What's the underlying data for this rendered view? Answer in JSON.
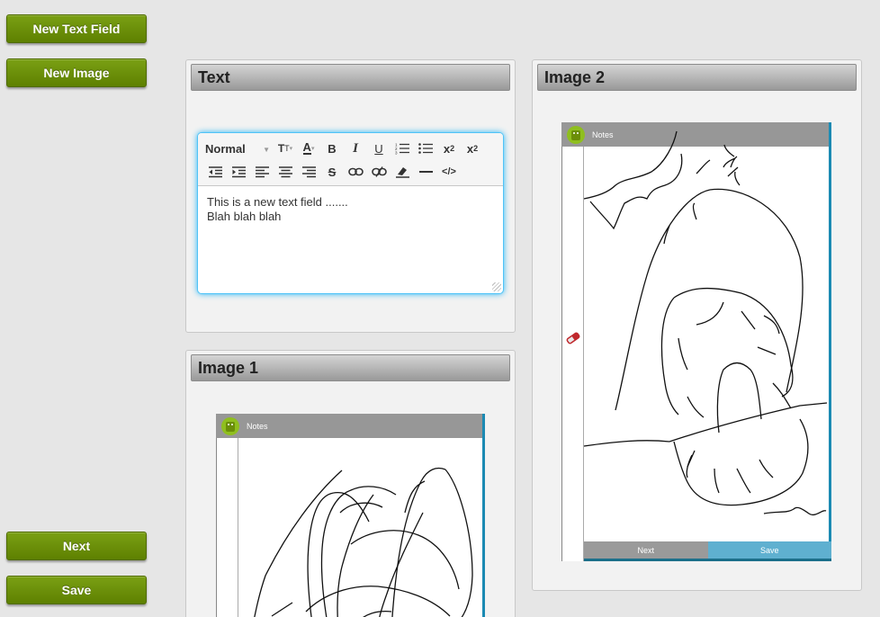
{
  "sidebar": {
    "new_text_field": "New Text Field",
    "new_image": "New Image",
    "next": "Next",
    "save": "Save"
  },
  "panels": {
    "text": {
      "title": "Text",
      "editor": {
        "style_select": "Normal",
        "content_line1": "This is a new text field .......",
        "content_line2": "Blah blah blah",
        "toolbar_icons": [
          "font-size-icon",
          "font-color-icon",
          "bold-icon",
          "italic-icon",
          "underline-icon",
          "ordered-list-icon",
          "unordered-list-icon",
          "subscript-icon",
          "superscript-icon",
          "outdent-icon",
          "indent-icon",
          "align-left-icon",
          "align-center-icon",
          "align-right-icon",
          "strikethrough-icon",
          "link-icon",
          "unlink-icon",
          "remove-format-icon",
          "horizontal-rule-icon",
          "source-code-icon"
        ]
      }
    },
    "image1": {
      "title": "Image 1",
      "screenshot_title": "Notes"
    },
    "image2": {
      "title": "Image 2",
      "screenshot_title": "Notes",
      "footer_next": "Next",
      "footer_save": "Save"
    }
  },
  "colors": {
    "button_green": "#6b8e08",
    "focus_blue": "#29b6f6",
    "app_bar_gray": "#979797",
    "save_blue": "#5fb0d0"
  }
}
